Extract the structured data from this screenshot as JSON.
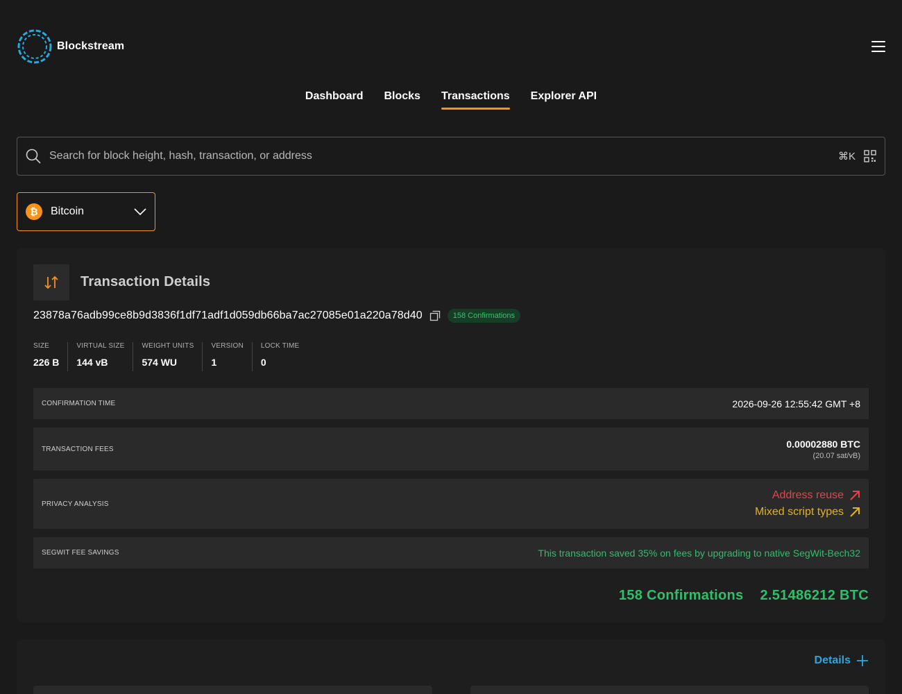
{
  "brand": {
    "name": "Blockstream"
  },
  "nav": {
    "items": [
      {
        "label": "Dashboard",
        "active": false
      },
      {
        "label": "Blocks",
        "active": false
      },
      {
        "label": "Transactions",
        "active": true
      },
      {
        "label": "Explorer API",
        "active": false
      }
    ]
  },
  "search": {
    "placeholder": "Search for block height, hash, transaction, or address",
    "shortcut": "⌘K"
  },
  "network": {
    "selected": "Bitcoin",
    "icon_glyph": "₿"
  },
  "transaction": {
    "title": "Transaction Details",
    "txid": "23878a76adb99ce8b9d3836f1df71adf1d059db66ba7ac27085e01a220a78d40",
    "confirmations_badge": "158 Confirmations",
    "stats": [
      {
        "label": "SIZE",
        "value": "226 B"
      },
      {
        "label": "VIRTUAL SIZE",
        "value": "144 vB"
      },
      {
        "label": "WEIGHT UNITS",
        "value": "574 WU"
      },
      {
        "label": "VERSION",
        "value": "1"
      },
      {
        "label": "LOCK TIME",
        "value": "0"
      }
    ],
    "confirmation_time": {
      "label": "CONFIRMATION TIME",
      "value": "2026-09-26 12:55:42 GMT +8"
    },
    "fees": {
      "label": "TRANSACTION FEES",
      "value": "0.00002880 BTC",
      "rate": "(20.07 sat/vB)"
    },
    "privacy": {
      "label": "PRIVACY ANALYSIS",
      "items": [
        {
          "label": "Address reuse",
          "color": "#e0464b"
        },
        {
          "label": "Mixed script types",
          "color": "#e3b21d"
        }
      ]
    },
    "segwit": {
      "label": "SEGWIT FEE SAVINGS",
      "value": "This transaction saved 35% on fees by upgrading to native SegWit-Bech32"
    },
    "summary": {
      "confirmations": "158 Confirmations",
      "amount": "2.51486212 BTC"
    }
  },
  "details": {
    "label": "Details"
  },
  "colors": {
    "accent": "#f7931a",
    "success": "#2fbf6a",
    "link": "#2aa7e0",
    "danger": "#e0464b",
    "warning": "#e3b21d"
  }
}
